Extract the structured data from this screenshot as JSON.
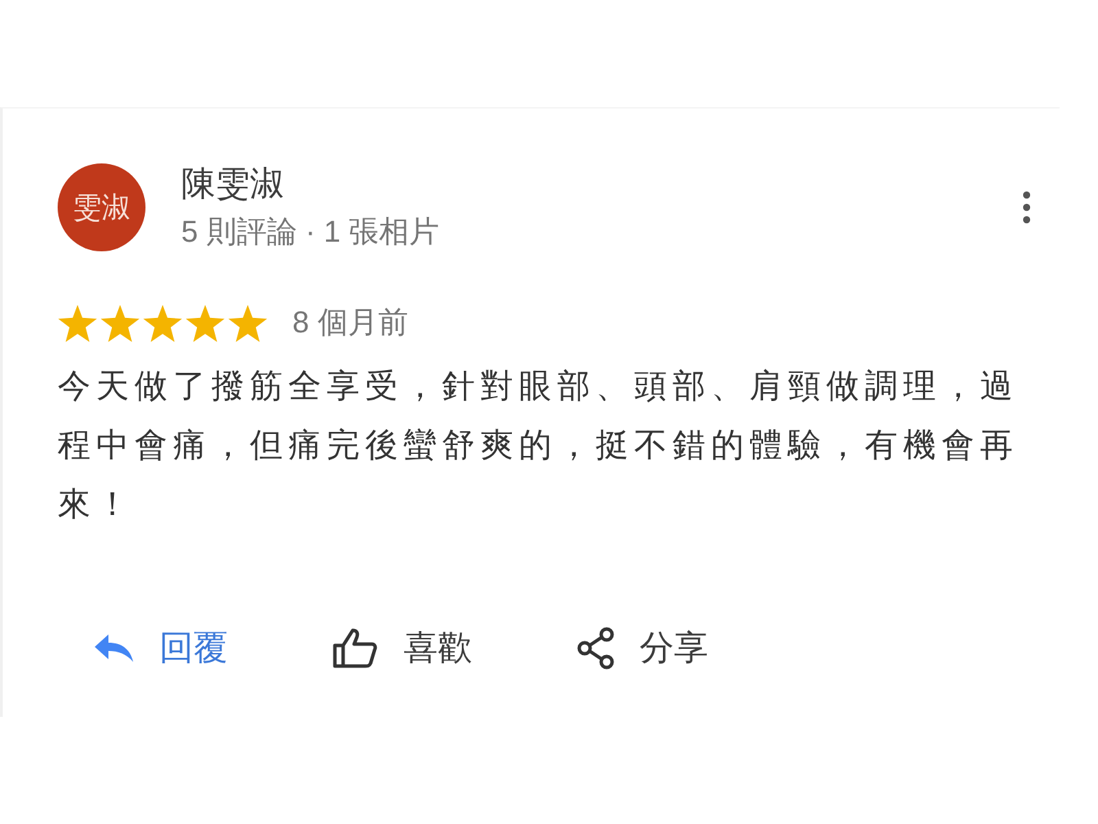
{
  "review": {
    "avatar": {
      "text": "雯淑",
      "color": "#c0391b"
    },
    "name": "陳雯淑",
    "meta": "5 則評論 · 1 張相片",
    "stars": 5,
    "time": "8 個月前",
    "body": "今天做了撥筋全享受，針對眼部、頭部、肩頸做調理，過程中會痛，但痛完後蠻舒爽的，挺不錯的體驗，有機會再來！",
    "actions": [
      {
        "kind": "reply",
        "label": "回覆"
      },
      {
        "kind": "like",
        "label": "喜歡"
      },
      {
        "kind": "share",
        "label": "分享"
      }
    ]
  }
}
